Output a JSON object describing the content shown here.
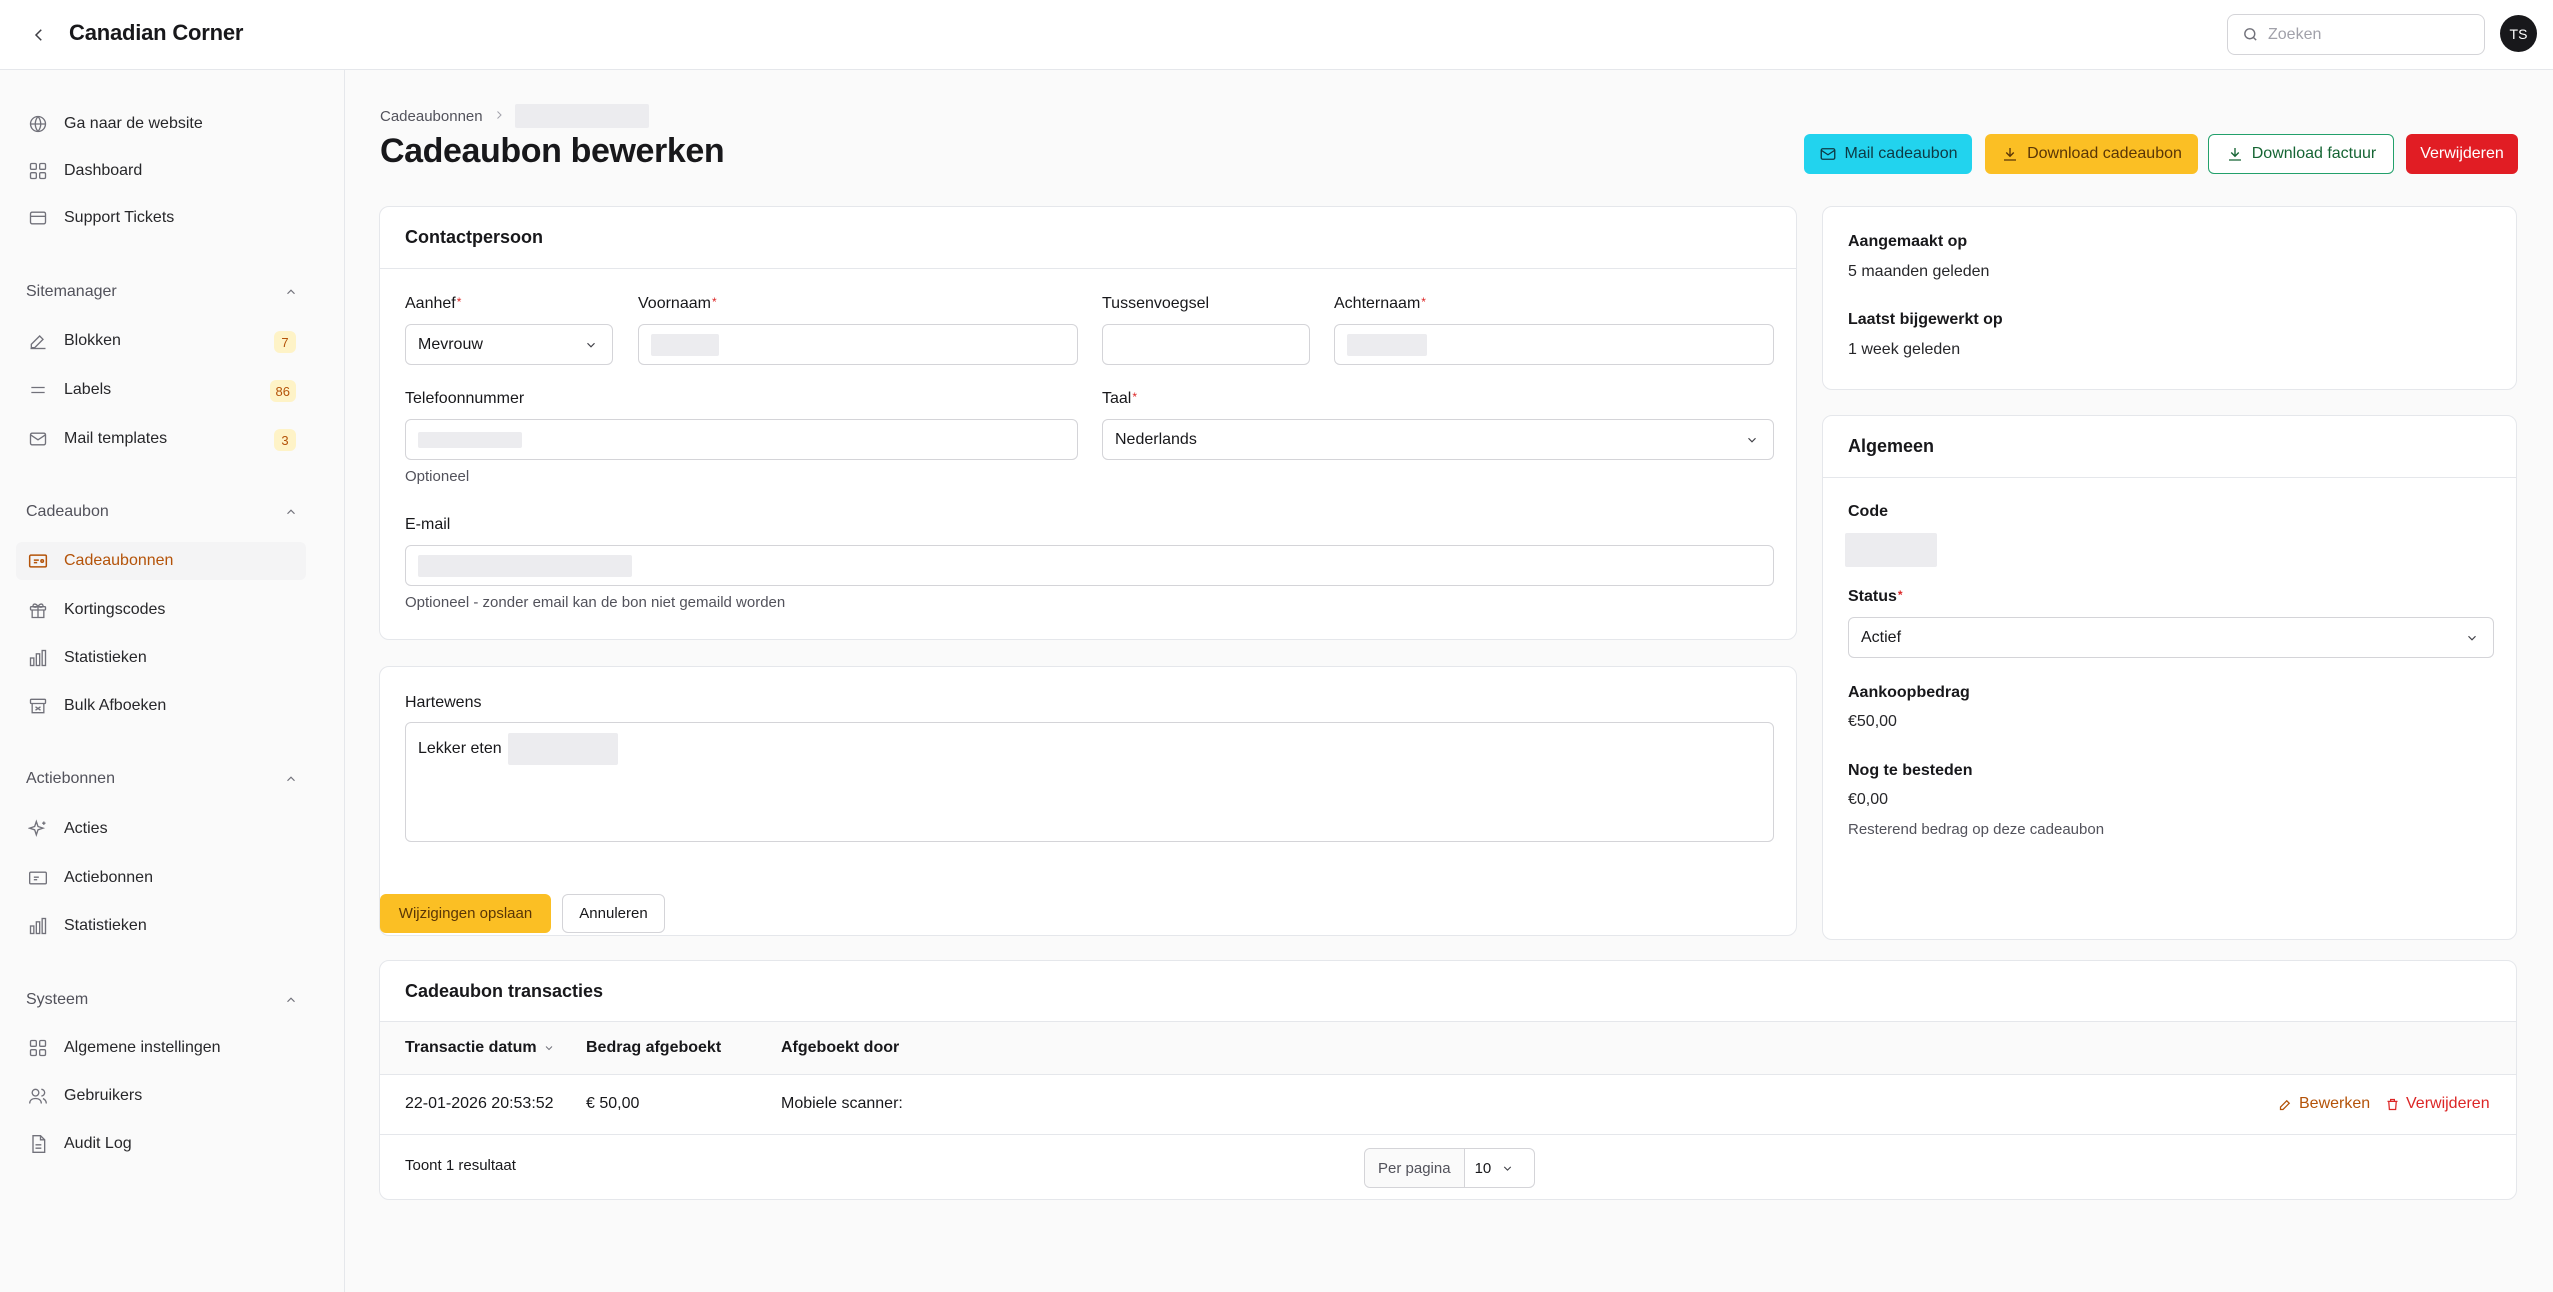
{
  "app": {
    "title": "Canadian Corner",
    "user_initials": "TS"
  },
  "search": {
    "placeholder": "Zoeken"
  },
  "sidebar": {
    "top_items": [
      {
        "label": "Ga naar de website"
      },
      {
        "label": "Dashboard"
      },
      {
        "label": "Support Tickets"
      }
    ],
    "groups": [
      {
        "title": "Sitemanager",
        "items": [
          {
            "label": "Blokken",
            "badge": "7"
          },
          {
            "label": "Labels",
            "badge": "86"
          },
          {
            "label": "Mail templates",
            "badge": "3"
          }
        ]
      },
      {
        "title": "Cadeaubon",
        "items": [
          {
            "label": "Cadeaubonnen"
          },
          {
            "label": "Kortingscodes"
          },
          {
            "label": "Statistieken"
          },
          {
            "label": "Bulk Afboeken"
          }
        ]
      },
      {
        "title": "Actiebonnen",
        "items": [
          {
            "label": "Acties"
          },
          {
            "label": "Actiebonnen"
          },
          {
            "label": "Statistieken"
          }
        ]
      },
      {
        "title": "Systeem",
        "items": [
          {
            "label": "Algemene instellingen"
          },
          {
            "label": "Gebruikers"
          },
          {
            "label": "Audit Log"
          }
        ]
      }
    ]
  },
  "breadcrumb": {
    "parent": "Cadeaubonnen"
  },
  "page": {
    "title": "Cadeaubon bewerken"
  },
  "actions": {
    "mail": "Mail cadeaubon",
    "download_voucher": "Download cadeaubon",
    "download_invoice": "Download factuur",
    "delete": "Verwijderen"
  },
  "contact": {
    "title": "Contactpersoon",
    "salutation_label": "Aanhef",
    "salutation_value": "Mevrouw",
    "firstname_label": "Voornaam",
    "infix_label": "Tussenvoegsel",
    "lastname_label": "Achternaam",
    "phone_label": "Telefoonnummer",
    "phone_hint": "Optioneel",
    "language_label": "Taal",
    "language_value": "Nederlands",
    "email_label": "E-mail",
    "email_hint": "Optioneel - zonder email kan de bon niet gemaild worden"
  },
  "wishes": {
    "label": "Hartewens",
    "value": "Lekker eten"
  },
  "form_buttons": {
    "save": "Wijzigingen opslaan",
    "cancel": "Annuleren"
  },
  "meta": {
    "created_label": "Aangemaakt op",
    "created_value": "5 maanden geleden",
    "updated_label": "Laatst bijgewerkt op",
    "updated_value": "1 week geleden"
  },
  "general": {
    "title": "Algemeen",
    "code_label": "Code",
    "status_label": "Status",
    "status_value": "Actief",
    "amount_label": "Aankoopbedrag",
    "amount_value": "€50,00",
    "remaining_label": "Nog te besteden",
    "remaining_value": "€0,00",
    "remaining_hint": "Resterend bedrag op deze cadeaubon"
  },
  "transactions": {
    "title": "Cadeaubon transacties",
    "columns": [
      "Transactie datum",
      "Bedrag afgeboekt",
      "Afgeboekt door"
    ],
    "rows": [
      {
        "date": "22-01-2026 20:53:52",
        "amount": "€ 50,00",
        "by": "Mobiele scanner:",
        "edit": "Bewerken",
        "delete": "Verwijderen"
      }
    ],
    "result_text": "Toont 1 resultaat",
    "per_page_label": "Per pagina",
    "per_page_value": "10"
  },
  "colors": {
    "accent": "#b45309",
    "cyan": "#22d3ee",
    "amber": "#fbbf24",
    "green": "#22a06b",
    "red": "#e11d24"
  }
}
